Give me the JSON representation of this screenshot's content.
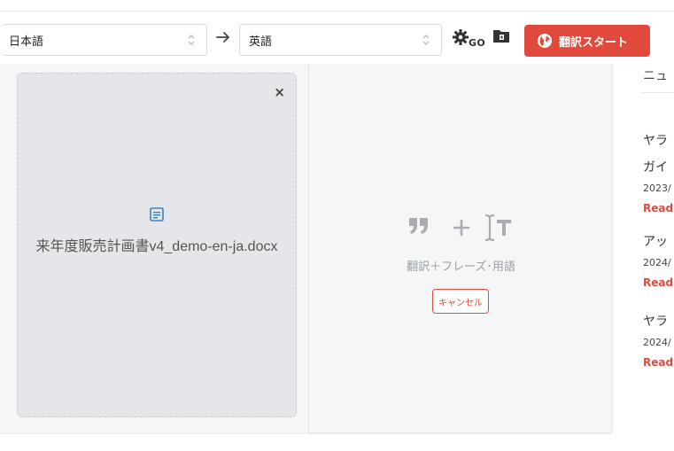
{
  "toolbar": {
    "source_language": "日本語",
    "target_language": "英語",
    "go_label": "GO",
    "start_button_label": "翻訳スタート"
  },
  "file_card": {
    "file_name": "来年度販売計画書v4_demo-en-ja.docx",
    "close_label": "×"
  },
  "options_panel": {
    "feature_label": "翻訳＋フレーズ･用語",
    "cancel_label": "キャンセル"
  },
  "news": {
    "header": "ニュ",
    "items": [
      {
        "title": "ヤラ",
        "title2": "ガイ",
        "date": "2023/",
        "read": "Read"
      },
      {
        "title": "アッ",
        "date": "2024/",
        "read": "Read"
      },
      {
        "title": "ヤラ",
        "date": "2024/",
        "read": "Read"
      }
    ]
  },
  "colors": {
    "accent": "#e2493d",
    "panel_bg": "#f4f6f8",
    "file_card_bg": "#e4e6e9",
    "doc_icon": "#3b82c4"
  },
  "icons": {
    "arrow": "arrow-right-icon",
    "settings": "gear-icon",
    "folder": "folder-icon",
    "globe": "globe-icon",
    "doc": "document-icon",
    "quote": "quote-icon",
    "plus": "plus-icon",
    "term": "text-cursor-icon"
  }
}
